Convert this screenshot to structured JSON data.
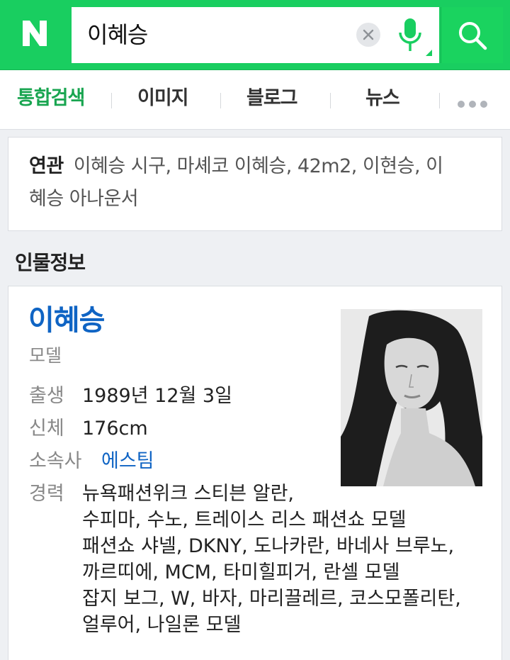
{
  "header": {
    "logo": "N",
    "query": "이혜승",
    "clear_icon": "close-icon",
    "mic_icon": "mic-icon",
    "search_icon": "search-icon",
    "brand_color": "#19ce60"
  },
  "tabs": [
    {
      "label": "통합검색",
      "active": true
    },
    {
      "label": "이미지",
      "active": false
    },
    {
      "label": "블로그",
      "active": false
    },
    {
      "label": "뉴스",
      "active": false
    }
  ],
  "related": {
    "label": "연관",
    "line1": "이혜승 시구, 마셰코 이혜승, 42m2, 이현승, 이",
    "line2": "혜승 아나운서"
  },
  "section_title": "인물정보",
  "profile": {
    "name": "이혜승",
    "job": "모델",
    "birth_key": "출생",
    "birth_val": "1989년 12월 3일",
    "body_key": "신체",
    "body_val": "176cm",
    "agency_key": "소속사",
    "agency_val": "에스팀",
    "career_key": "경력",
    "career": [
      "뉴욕패션위크 스티븐 알란,",
      "수피마, 수노, 트레이스 리스 패션쇼 모델",
      "패션쇼 샤넬, DKNY, 도나카란, 바네사 브루노,",
      "까르띠에, MCM, 타미힐피거, 란셀 모델",
      "잡지 보그, W, 바자, 마리끌레르, 코스모폴리탄,",
      "얼루어, 나일론 모델"
    ]
  }
}
